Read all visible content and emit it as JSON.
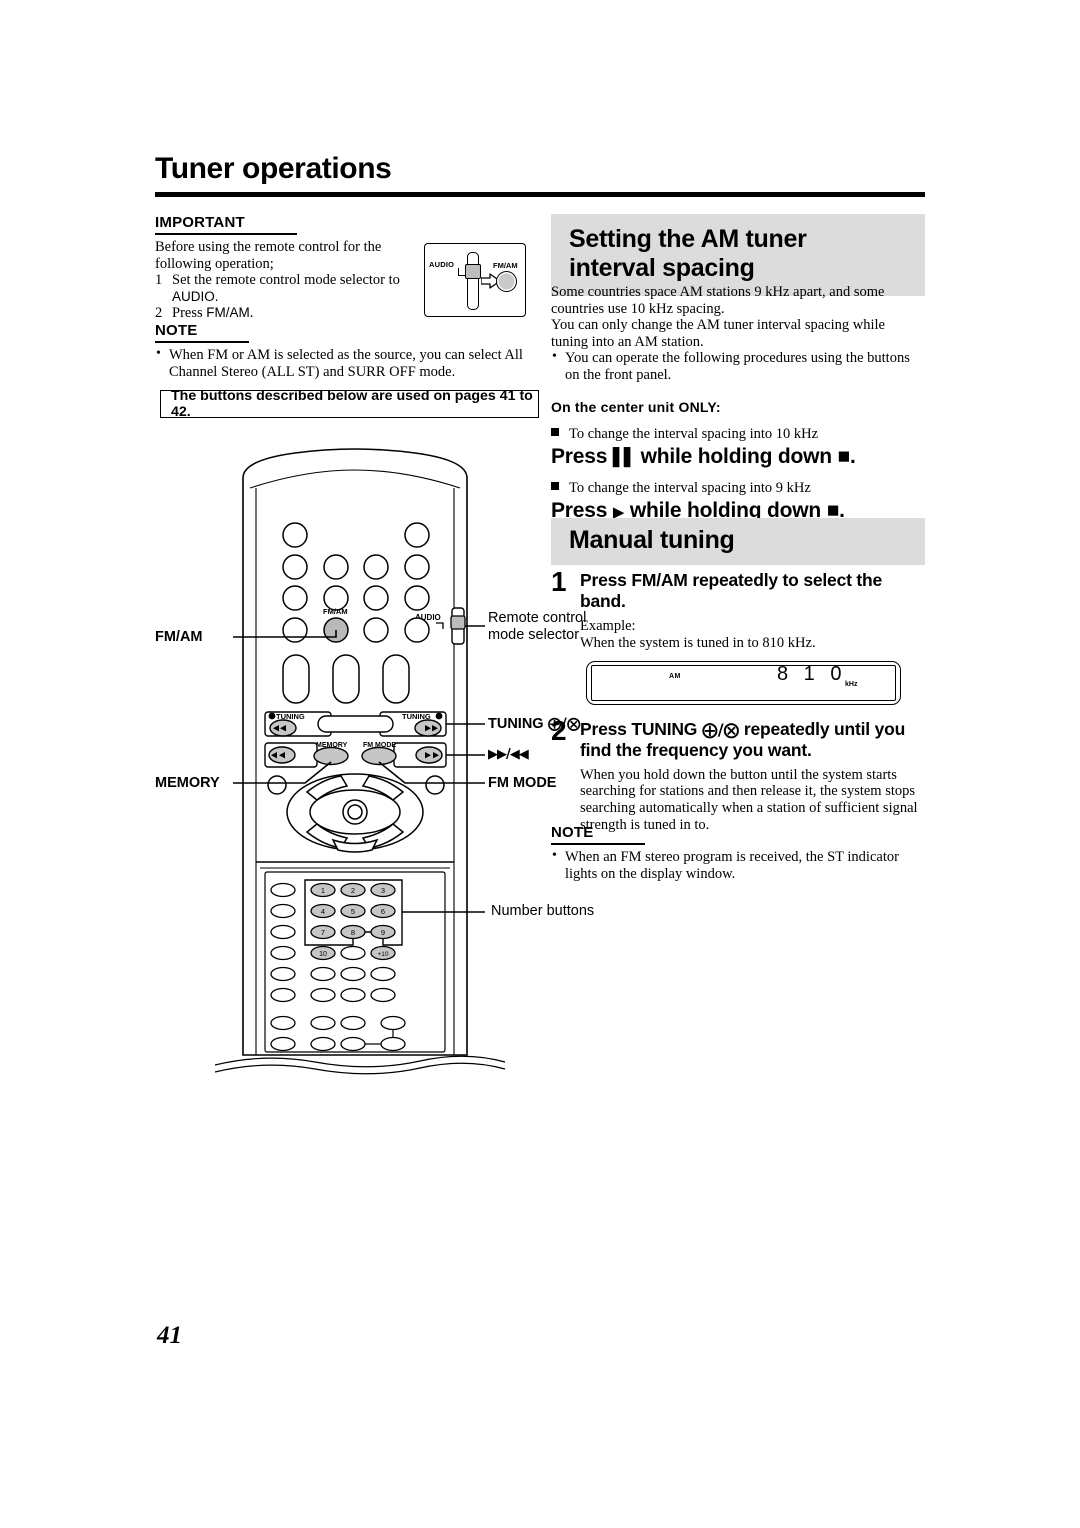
{
  "page": {
    "title": "Tuner operations",
    "number": "41"
  },
  "important": {
    "heading": "IMPORTANT",
    "intro_line1": "Before using the remote control for the",
    "intro_line2": "following operation;",
    "items": [
      {
        "num": "1",
        "text_a": "Set the remote control mode selector to",
        "text_b": "AUDIO."
      },
      {
        "num": "2",
        "text_a": "Press FM/AM.",
        "text_b": ""
      }
    ]
  },
  "mode_inset": {
    "audio_label": "AUDIO",
    "fmam_label": "FM/AM"
  },
  "note_left": {
    "heading": "NOTE",
    "bullet": "When FM or AM is selected as the source, you can select All Channel Stereo (ALL ST) and SURR OFF mode."
  },
  "buttons_used_box": {
    "text": "The buttons described below are used on pages 41 to 42."
  },
  "am_section": {
    "heading_line1": "Setting the AM tuner",
    "heading_line2": "interval spacing",
    "para1": "Some countries space AM stations 9 kHz apart, and some countries use 10 kHz spacing.",
    "para2": "You can only change the AM tuner interval spacing while tuning into an AM station.",
    "bullet1": "You can operate the following procedures using the buttons on the front panel.",
    "center_unit_only": "On the center unit ONLY:",
    "sub1_caption": "To change the interval spacing into 10 kHz",
    "sub1_press": "Press ▐▐ while holding down ■.",
    "sub1_press_pre": "Press",
    "sub1_press_symbol": "▌▌",
    "sub1_press_mid": "while holding down",
    "sub1_press_end": "■.",
    "sub2_caption": "To change the interval spacing into 9 kHz",
    "sub2_press_pre": "Press",
    "sub2_press_symbol": "▶",
    "sub2_press_mid": "while holding down",
    "sub2_press_end": "■."
  },
  "manual_section": {
    "heading": "Manual tuning",
    "steps": [
      {
        "num": "1",
        "title": "Press FM/AM repeatedly to select the band.",
        "body_line1": "Example:",
        "body_line2": "When the system is tuned in to 810 kHz."
      },
      {
        "num": "2",
        "title": "Press TUNING ⊕/⊖ repeatedly until you find the frequency you want.",
        "title_pre": "Press TUNING",
        "title_sym": "⊕/⊖",
        "title_post": "repeatedly until you find the frequency you want.",
        "body": "When you hold down the button until the system starts searching for stations and then release it, the system stops searching automatically when a station of sufficient signal strength is tuned in to."
      }
    ],
    "display": {
      "band_indicator": "AM",
      "frequency": "8 1 0",
      "unit": "kHz"
    }
  },
  "note_right": {
    "heading": "NOTE",
    "bullet": "When an FM stereo program is received, the ST indicator lights on the display window."
  },
  "remote_callouts": {
    "fm_am": "FM/AM",
    "memory": "MEMORY",
    "mode_selector_line1": "Remote control",
    "mode_selector_line2": "mode selector",
    "tuning_pre": "TUNING",
    "tuning_sym": "⊕/⊖",
    "skip": "▶▶/◀◀",
    "fm_mode": "FM MODE",
    "number_buttons": "Number buttons",
    "remote_fm_am_cap": "FM/AM",
    "remote_audio_cap": "AUDIO",
    "remote_tuning_left_cap": "TUNING",
    "remote_tuning_right_cap": "TUNING",
    "remote_memory_cap": "MEMORY",
    "remote_fmmode_cap": "FM MODE",
    "number_keys": [
      "1",
      "2",
      "3",
      "4",
      "5",
      "6",
      "7",
      "8",
      "9",
      "10",
      "+10"
    ]
  },
  "colors": {
    "heading_band": "#dcdcdc",
    "button_gray": "#c9c9c9",
    "ink": "#000000",
    "paper": "#ffffff"
  }
}
